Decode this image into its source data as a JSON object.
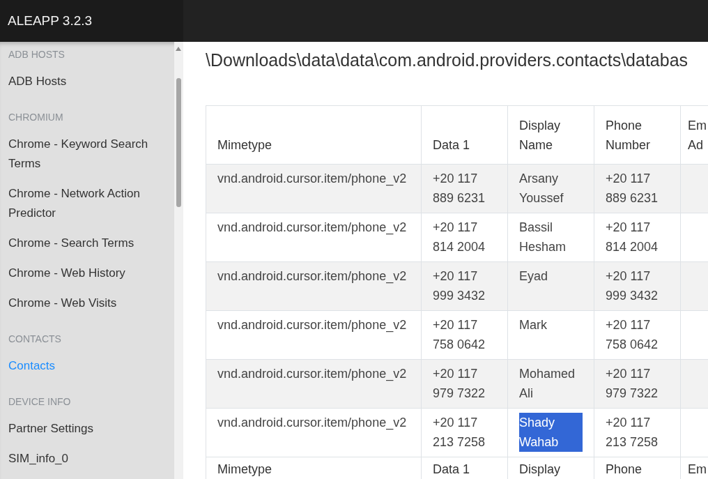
{
  "app_title": "ALEAPP 3.2.3",
  "sidebar": [
    {
      "heading": "ADB HOSTS",
      "items": [
        {
          "label": "ADB Hosts",
          "selected": false
        }
      ]
    },
    {
      "heading": "CHROMIUM",
      "items": [
        {
          "label": "Chrome - Keyword Search Terms",
          "selected": false
        },
        {
          "label": "Chrome - Network Action Predictor",
          "selected": false
        },
        {
          "label": "Chrome - Search Terms",
          "selected": false
        },
        {
          "label": "Chrome - Web History",
          "selected": false
        },
        {
          "label": "Chrome - Web Visits",
          "selected": false
        }
      ]
    },
    {
      "heading": "CONTACTS",
      "items": [
        {
          "label": "Contacts",
          "selected": true
        }
      ]
    },
    {
      "heading": "DEVICE INFO",
      "items": [
        {
          "label": "Partner Settings",
          "selected": false
        },
        {
          "label": "SIM_info_0",
          "selected": false
        }
      ]
    }
  ],
  "path": "\\Downloads\\data\\data\\com.android.providers.contacts\\databas",
  "table": {
    "columns": [
      "Mimetype",
      "Data 1",
      "Display Name",
      "Phone Number",
      "Em Ad"
    ],
    "rows": [
      {
        "mimetype": "vnd.android.cursor.item/phone_v2",
        "data_1": "+20 117 889 6231",
        "display_name": "Arsany Youssef",
        "name_highlighted": false,
        "phone_number": "+20 117 889 6231"
      },
      {
        "mimetype": "vnd.android.cursor.item/phone_v2",
        "data_1": "+20 117 814 2004",
        "display_name": "Bassil Hesham",
        "name_highlighted": false,
        "phone_number": "+20 117 814 2004"
      },
      {
        "mimetype": "vnd.android.cursor.item/phone_v2",
        "data_1": "+20 117 999 3432",
        "display_name": "Eyad",
        "name_highlighted": false,
        "phone_number": "+20 117 999 3432"
      },
      {
        "mimetype": "vnd.android.cursor.item/phone_v2",
        "data_1": "+20 117 758 0642",
        "display_name": "Mark",
        "name_highlighted": false,
        "phone_number": "+20 117 758 0642"
      },
      {
        "mimetype": "vnd.android.cursor.item/phone_v2",
        "data_1": "+20 117 979 7322",
        "display_name": "Mohamed Ali",
        "name_highlighted": false,
        "phone_number": "+20 117 979 7322"
      },
      {
        "mimetype": "vnd.android.cursor.item/phone_v2",
        "data_1": "+20 117 213 7258",
        "display_name": "Shady Wahab",
        "name_highlighted": true,
        "phone_number": "+20 117 213 7258"
      }
    ],
    "footer_columns": [
      "Mimetype",
      "Data 1",
      "Display",
      "Phone",
      "Em"
    ]
  }
}
